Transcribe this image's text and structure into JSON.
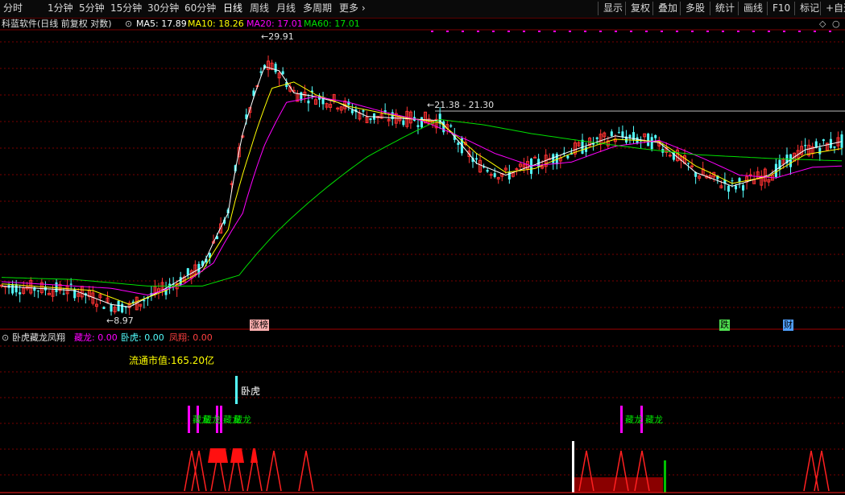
{
  "toolbar": {
    "periods": [
      "分时",
      "1分钟",
      "5分钟",
      "15分钟",
      "30分钟",
      "60分钟",
      "日线",
      "周线",
      "月线",
      "多周期",
      "更多"
    ],
    "active_period": "日线",
    "right": [
      "显示",
      "复权",
      "叠加",
      "多股",
      "统计",
      "画线",
      "F10",
      "标记",
      "+自选"
    ]
  },
  "main": {
    "stock_label": "科蓝软件(日线 前复权 对数)",
    "ma5": "MA5: 17.89",
    "ma10": "MA10: 18.26",
    "ma20": "MA20: 17.01",
    "ma60": "MA60: 17.01",
    "high_label": "29.91",
    "low_label": "8.97",
    "range_label": "21.38 - 21.30",
    "event_labels": [
      "涨榜",
      "跌",
      "财"
    ]
  },
  "sub": {
    "indicator": "卧虎藏龙凤翔",
    "cang_long": "藏龙: 0.00",
    "wo_hu": "卧虎: 0.00",
    "feng_xiang": "凤翔: 0.00",
    "market_cap": "流通市值:165.20亿",
    "wohu_label": "卧虎",
    "canglong_labels": [
      "藏龙",
      "藏龙",
      "藏龙",
      "藏龙",
      "藏龙",
      "藏龙"
    ]
  },
  "colors": {
    "up": "#ff3232",
    "down": "#54ffff",
    "ma5": "#ffffff",
    "ma10": "#ffff00",
    "ma20": "#ff00ff",
    "ma60": "#00e000",
    "grid": "#7a0000"
  },
  "chart_data": {
    "type": "candlestick",
    "scale": "log",
    "x_range": [
      0,
      230
    ],
    "y_range": [
      8.6,
      31.5
    ],
    "ma_series": [
      {
        "name": "MA5",
        "anchors": [
          [
            0,
            10.1
          ],
          [
            20,
            9.9
          ],
          [
            30,
            9.3
          ],
          [
            35,
            9.2
          ],
          [
            45,
            10.0
          ],
          [
            55,
            11.0
          ],
          [
            62,
            14.0
          ],
          [
            66,
            20.0
          ],
          [
            72,
            27.0
          ],
          [
            76,
            26.5
          ],
          [
            80,
            24.0
          ],
          [
            86,
            23.6
          ],
          [
            92,
            23.0
          ],
          [
            100,
            21.6
          ],
          [
            110,
            21.4
          ],
          [
            120,
            21.2
          ],
          [
            130,
            17.5
          ],
          [
            138,
            16.6
          ],
          [
            146,
            17.4
          ],
          [
            156,
            18.5
          ],
          [
            168,
            19.8
          ],
          [
            180,
            19.2
          ],
          [
            190,
            16.8
          ],
          [
            200,
            15.8
          ],
          [
            210,
            16.6
          ],
          [
            220,
            18.6
          ],
          [
            230,
            19.3
          ]
        ]
      },
      {
        "name": "MA10",
        "anchors": [
          [
            0,
            10.2
          ],
          [
            25,
            9.9
          ],
          [
            35,
            9.3
          ],
          [
            45,
            9.9
          ],
          [
            55,
            10.8
          ],
          [
            62,
            13.0
          ],
          [
            68,
            18.5
          ],
          [
            74,
            24.5
          ],
          [
            80,
            25.2
          ],
          [
            86,
            23.8
          ],
          [
            95,
            22.6
          ],
          [
            110,
            21.5
          ],
          [
            120,
            21.0
          ],
          [
            130,
            18.3
          ],
          [
            138,
            16.8
          ],
          [
            146,
            17.1
          ],
          [
            156,
            18.3
          ],
          [
            168,
            19.5
          ],
          [
            180,
            19.3
          ],
          [
            190,
            17.3
          ],
          [
            200,
            16.0
          ],
          [
            210,
            16.5
          ],
          [
            220,
            18.2
          ],
          [
            230,
            18.7
          ]
        ]
      },
      {
        "name": "MA20",
        "anchors": [
          [
            0,
            10.3
          ],
          [
            30,
            10.0
          ],
          [
            40,
            9.7
          ],
          [
            50,
            10.2
          ],
          [
            58,
            11.2
          ],
          [
            66,
            14.0
          ],
          [
            72,
            19.0
          ],
          [
            78,
            23.0
          ],
          [
            86,
            23.6
          ],
          [
            95,
            23.0
          ],
          [
            105,
            22.0
          ],
          [
            115,
            21.2
          ],
          [
            125,
            19.8
          ],
          [
            135,
            18.3
          ],
          [
            145,
            17.3
          ],
          [
            156,
            17.6
          ],
          [
            168,
            18.9
          ],
          [
            180,
            19.4
          ],
          [
            192,
            17.9
          ],
          [
            202,
            16.6
          ],
          [
            212,
            16.4
          ],
          [
            222,
            17.2
          ],
          [
            230,
            17.3
          ]
        ]
      },
      {
        "name": "MA60",
        "anchors": [
          [
            0,
            10.5
          ],
          [
            20,
            10.4
          ],
          [
            40,
            10.1
          ],
          [
            55,
            10.1
          ],
          [
            65,
            10.6
          ],
          [
            75,
            12.8
          ],
          [
            88,
            15.5
          ],
          [
            100,
            18.0
          ],
          [
            112,
            20.0
          ],
          [
            120,
            21.3
          ],
          [
            132,
            20.8
          ],
          [
            145,
            20.0
          ],
          [
            160,
            19.3
          ],
          [
            175,
            18.7
          ],
          [
            190,
            18.2
          ],
          [
            210,
            17.9
          ],
          [
            230,
            17.7
          ]
        ]
      }
    ],
    "sub_indicator": {
      "cang_long": 0.0,
      "wo_hu": 0.0,
      "feng_xiang": 0.0,
      "market_cap": "165.20亿"
    }
  }
}
